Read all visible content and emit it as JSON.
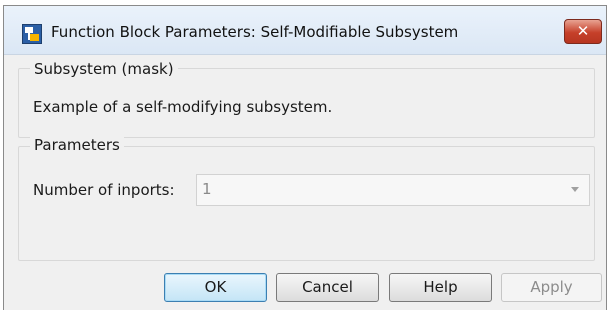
{
  "window": {
    "title": "Function Block Parameters: Self-Modifiable Subsystem",
    "app_icon": "simulink-block-icon",
    "close_symbol": "✕"
  },
  "mask_group": {
    "label": "Subsystem (mask)",
    "description": "Example of a self-modifying subsystem."
  },
  "params_group": {
    "label": "Parameters",
    "inports_label": "Number of inports:",
    "inports_value": "1",
    "inports_enabled": false
  },
  "buttons": {
    "ok": "OK",
    "cancel": "Cancel",
    "help": "Help",
    "apply": "Apply"
  },
  "colors": {
    "close_button": "#c6402a",
    "primary_button_border": "#3c7fb1"
  }
}
